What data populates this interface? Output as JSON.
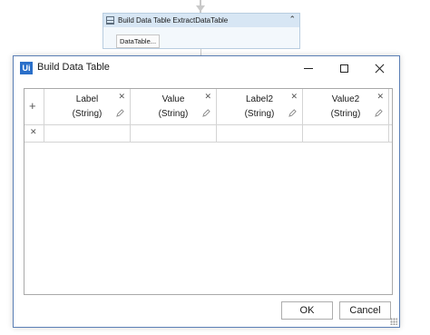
{
  "workflow": {
    "activity_title": "Build Data Table ExtractDataTable",
    "activity_button": "DataTable...",
    "icons": {
      "activity": "datatable-icon",
      "collapse": "chevron-double-up-icon"
    }
  },
  "dialog": {
    "title": "Build Data Table",
    "app_icon": "Ui",
    "controls": {
      "minimize": "minimize-icon",
      "maximize": "maximize-icon",
      "close": "close-icon"
    },
    "grid": {
      "add_column_glyph": "+",
      "remove_row_glyph": "✕",
      "columns": [
        {
          "name": "Label",
          "type": "(String)"
        },
        {
          "name": "Value",
          "type": "(String)"
        },
        {
          "name": "Label2",
          "type": "(String)"
        },
        {
          "name": "Value2",
          "type": "(String)"
        }
      ],
      "rows": [
        [
          "",
          "",
          "",
          ""
        ]
      ]
    },
    "buttons": {
      "ok": "OK",
      "cancel": "Cancel"
    }
  }
}
